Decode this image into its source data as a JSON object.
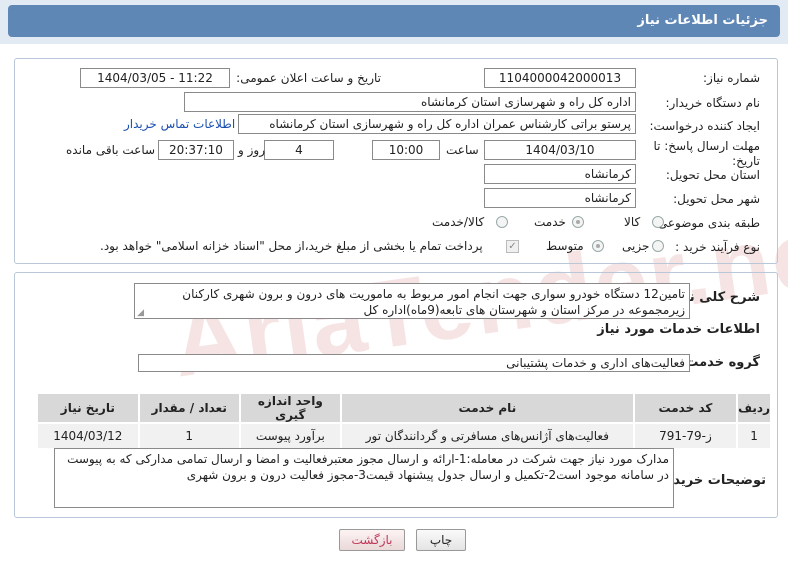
{
  "page_title": "جزئیات اطلاعات نیاز",
  "watermark": "AriaTender.neT",
  "fields": {
    "need_number_label": "شماره نیاز:",
    "need_number": "1104000042000013",
    "announce_label": "تاریخ و ساعت اعلان عمومی:",
    "announce_value": "1404/03/05 - 11:22",
    "buyer_org_label": "نام دستگاه خریدار:",
    "buyer_org": "اداره کل راه و شهرسازی استان کرمانشاه",
    "creator_label": "ایجاد کننده درخواست:",
    "creator": "پرستو براتی کارشناس عمران اداره کل راه و شهرسازی استان کرمانشاه",
    "contact_link": "اطلاعات تماس خریدار",
    "deadline_label": "مهلت ارسال پاسخ: تا تاریخ:",
    "deadline_date": "1404/03/10",
    "time_label": "ساعت",
    "deadline_time": "10:00",
    "days_value": "4",
    "days_label": "روز و",
    "remaining_time": "20:37:10",
    "remaining_label": "ساعت باقی مانده",
    "province_label": "استان محل تحویل:",
    "province": "کرمانشاه",
    "city_label": "شهر محل تحویل:",
    "city": "کرمانشاه",
    "category_label": "طبقه بندی موضوعی:",
    "category_options": [
      "کالا",
      "خدمت",
      "کالا/خدمت"
    ],
    "process_label": "نوع فرآیند خرید :",
    "process_options": [
      "جزیی",
      "متوسط"
    ],
    "payment_note": "پرداخت تمام یا بخشی از مبلغ خرید،از محل \"اسناد خزانه اسلامی\" خواهد بود."
  },
  "summary": {
    "label": "شرح کلی نیاز:",
    "text": "تامین12 دستگاه خودرو سواری جهت انجام امور مربوط به ماموریت های درون و برون شهری کارکنان زیرمجموعه در مرکز استان و شهرستان های تابعه(9ماه)اداره کل"
  },
  "services": {
    "section_title": "اطلاعات خدمات مورد نیاز",
    "group_label": "گروه خدمت:",
    "group_value": "فعالیت‌های اداری و خدمات پشتیبانی",
    "table": {
      "headers": [
        "ردیف",
        "کد خدمت",
        "نام خدمت",
        "واحد اندازه گیری",
        "تعداد / مقدار",
        "تاریخ نیاز"
      ],
      "rows": [
        [
          "1",
          "ز-79-791",
          "فعالیت‌های آژانس‌های مسافرتی و گردانندگان تور",
          "برآورد پیوست",
          "1",
          "1404/03/12"
        ]
      ]
    }
  },
  "buyer_notes": {
    "label": "توضیحات خریدار:",
    "text": "مدارک مورد نیاز جهت شرکت در معامله:1-ارائه و ارسال مجوز معتبرفعالیت و امضا و ارسال تمامی مدارکی که به پیوست در سامانه موجود است2-تکمیل و ارسال جدول پیشنهاد قیمت3-مجوز فعالیت درون و برون شهری"
  },
  "buttons": {
    "print": "چاپ",
    "back": "بازگشت"
  }
}
